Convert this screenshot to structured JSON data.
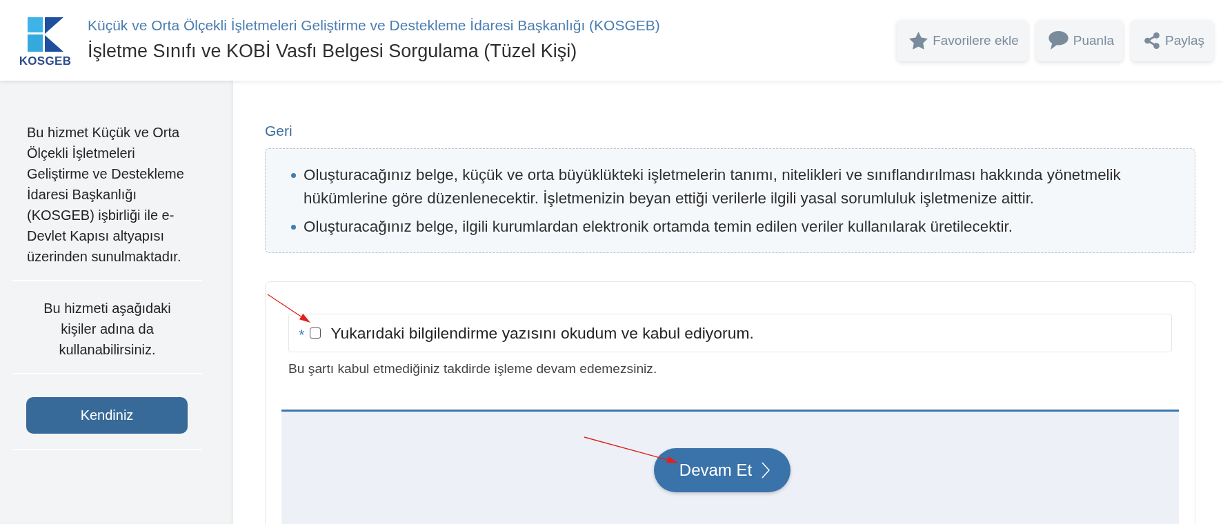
{
  "header": {
    "logo_text": "KOSGEB",
    "agency": "Küçük ve Orta Ölçekli İşletmeleri Geliştirme ve Destekleme İdaresi Başkanlığı (KOSGEB)",
    "title": "İşletme Sınıfı ve KOBİ Vasfı Belgesi Sorgulama (Tüzel Kişi)",
    "actions": [
      {
        "kind": "favorite",
        "label": "Favorilere ekle"
      },
      {
        "kind": "rate",
        "label": "Puanla"
      },
      {
        "kind": "share",
        "label": "Paylaş"
      }
    ]
  },
  "sidebar": {
    "description": "Bu hizmet Küçük ve Orta Ölçekli İşletmeleri Geliştirme ve Destekleme İdaresi Başkanlığı (KOSGEB) işbirliği ile e-Devlet Kapısı altyapısı üzerinden sunulmaktadır.",
    "on_behalf_note": "Bu hizmeti aşağıdaki kişiler adına da kullanabilirsiniz.",
    "options": [
      {
        "label": "Kendiniz"
      }
    ]
  },
  "main": {
    "back_link": "Geri",
    "info_items": [
      "Oluşturacağınız belge, küçük ve orta büyüklükteki işletmelerin tanımı, nitelikleri ve sınıflandırılması hakkında yönetmelik hükümlerine göre düzenlenecektir. İşletmenizin beyan ettiği verilerle ilgili yasal sorumluluk işletmenize aittir.",
      "Oluşturacağınız belge, ilgili kurumlardan elektronik ortamda temin edilen veriler kullanılarak üretilecektir."
    ],
    "consent": {
      "required_mark": "*",
      "label": "Yukarıdaki bilgilendirme yazısını okudum ve kabul ediyorum.",
      "checked": false,
      "hint": "Bu şartı kabul etmediğiniz takdirde işleme devam edemezsiniz."
    },
    "submit": {
      "label": "Devam Et"
    }
  }
}
